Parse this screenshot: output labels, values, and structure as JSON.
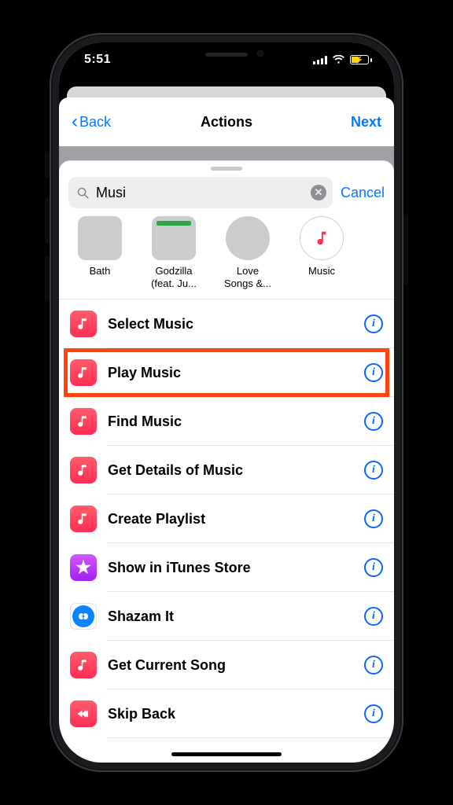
{
  "status": {
    "time": "5:51"
  },
  "nav": {
    "back": "Back",
    "title": "Actions",
    "next": "Next"
  },
  "search": {
    "value": "Musi",
    "cancel": "Cancel"
  },
  "tiles": [
    {
      "line1": "Bath",
      "line2": ""
    },
    {
      "line1": "Godzilla",
      "line2": "(feat. Ju..."
    },
    {
      "line1": "Love",
      "line2": "Songs &..."
    },
    {
      "line1": "Music",
      "line2": ""
    }
  ],
  "actions": [
    {
      "label": "Select Music",
      "icon": "music"
    },
    {
      "label": "Play Music",
      "icon": "music"
    },
    {
      "label": "Find Music",
      "icon": "music"
    },
    {
      "label": "Get Details of Music",
      "icon": "music"
    },
    {
      "label": "Create Playlist",
      "icon": "music"
    },
    {
      "label": "Show in iTunes Store",
      "icon": "itunes"
    },
    {
      "label": "Shazam It",
      "icon": "shazam"
    },
    {
      "label": "Get Current Song",
      "icon": "music"
    },
    {
      "label": "Skip Back",
      "icon": "skip"
    }
  ],
  "highlight_index": 1
}
